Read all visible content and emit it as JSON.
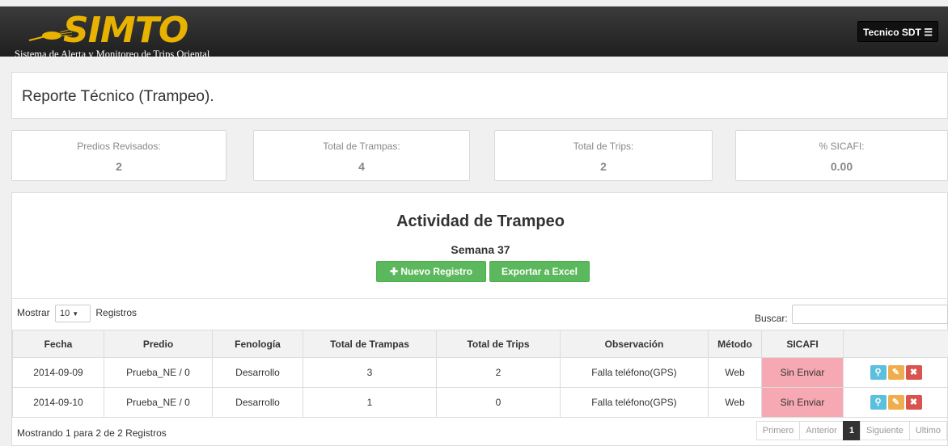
{
  "header": {
    "logo": "SIMTO",
    "subtitle": "Sistema de Alerta y Monitoreo de Trips Oriental",
    "user_label": "Tecnico SDT",
    "user_icon": "menu-icon"
  },
  "page_title": "Reporte Técnico (Trampeo).",
  "stats": [
    {
      "label": "Predios Revisados:",
      "value": "2"
    },
    {
      "label": "Total de Trampas:",
      "value": "4"
    },
    {
      "label": "Total de Trips:",
      "value": "2"
    },
    {
      "label": "% SICAFI:",
      "value": "0.00"
    }
  ],
  "activity": {
    "title": "Actividad de Trampeo",
    "week": "Semana 37",
    "new_button": "Nuevo Registro",
    "export_button": "Exportar a Excel",
    "colors": {
      "success": "#5cb85c",
      "danger_bg": "#f7a9b3"
    }
  },
  "table_controls": {
    "show_label": "Mostrar",
    "page_size": "10",
    "records_label": "Registros",
    "search_label": "Buscar:"
  },
  "table": {
    "headers": [
      "Fecha",
      "Predio",
      "Fenología",
      "Total de Trampas",
      "Total de Trips",
      "Observación",
      "Método",
      "SICAFI",
      ""
    ],
    "rows": [
      {
        "fecha": "2014-09-09",
        "predio": "Prueba_NE / 0",
        "fenologia": "Desarrollo",
        "trampas": "3",
        "trips": "2",
        "observacion": "Falla teléfono(GPS)",
        "metodo": "Web",
        "sicafi": "Sin Enviar"
      },
      {
        "fecha": "2014-09-10",
        "predio": "Prueba_NE / 0",
        "fenologia": "Desarrollo",
        "trampas": "1",
        "trips": "0",
        "observacion": "Falla teléfono(GPS)",
        "metodo": "Web",
        "sicafi": "Sin Enviar"
      }
    ]
  },
  "footer": {
    "info": "Mostrando 1 para 2 de 2 Registros",
    "pager": {
      "first": "Primero",
      "prev": "Anterior",
      "current": "1",
      "next": "Siguiente",
      "last": "Ultimo"
    }
  }
}
